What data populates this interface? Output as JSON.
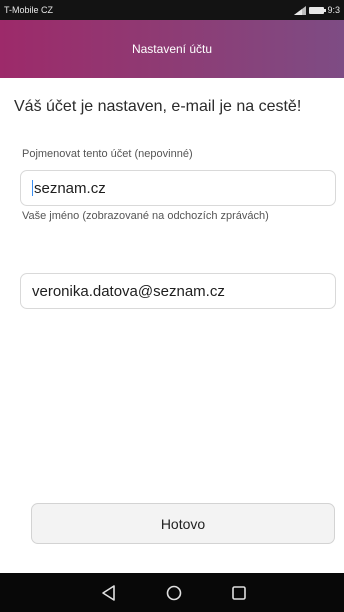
{
  "status_bar": {
    "carrier": "T-Mobile CZ",
    "time": "9:3"
  },
  "header": {
    "title": "Nastavení účtu"
  },
  "main": {
    "headline": "Váš účet je nastaven, e-mail je na cestě!",
    "account_name_label": "Pojmenovat tento účet (nepovinné)",
    "account_name_value": "seznam.cz",
    "your_name_label": "Vaše jméno (zobrazované na odchozích zprávách)",
    "your_name_value": "veronika.datova@seznam.cz"
  },
  "actions": {
    "done_label": "Hotovo"
  },
  "nav_bar": {
    "icons": [
      "back-icon",
      "home-icon",
      "recents-icon"
    ]
  },
  "colors": {
    "header_gradient_start": "#9d2a6a",
    "header_gradient_end": "#7e4c84",
    "caret": "#3a8ef0"
  }
}
